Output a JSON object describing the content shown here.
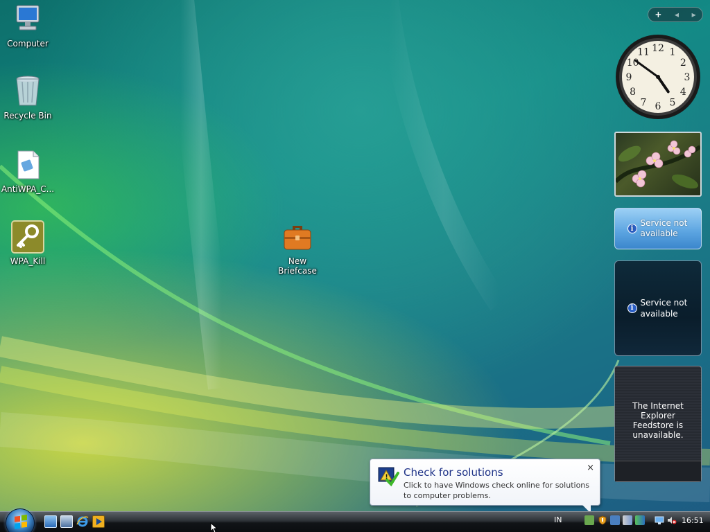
{
  "desktop": {
    "icons": [
      {
        "label": "Computer",
        "icon": "computer-icon"
      },
      {
        "label": "Recycle Bin",
        "icon": "recycle-bin-icon"
      },
      {
        "label": "AntiWPA_C...",
        "icon": "document-icon"
      },
      {
        "label": "WPA_Kill",
        "icon": "key-icon"
      },
      {
        "label": "New Briefcase",
        "icon": "briefcase-icon"
      }
    ]
  },
  "gadgets": {
    "toolbar": {
      "add": "+",
      "prev": "◂",
      "next": "▸"
    },
    "clock": {
      "numerals": [
        "12",
        "1",
        "2",
        "3",
        "4",
        "5",
        "6",
        "7",
        "8",
        "9",
        "10",
        "11"
      ],
      "time": "16:51"
    },
    "weather": {
      "message": "Service not available"
    },
    "stocks": {
      "message": "Service not available"
    },
    "feeds": {
      "message": "The Internet Explorer Feedstore is unavailable."
    }
  },
  "balloon": {
    "title": "Check for solutions",
    "body": "Click to have Windows check online for solutions to computer problems.",
    "close": "×"
  },
  "taskbar": {
    "language": "IN",
    "time": "16:51"
  },
  "colors": {
    "balloon_title": "#1e3287",
    "info_blue": "#2a5ec4"
  }
}
